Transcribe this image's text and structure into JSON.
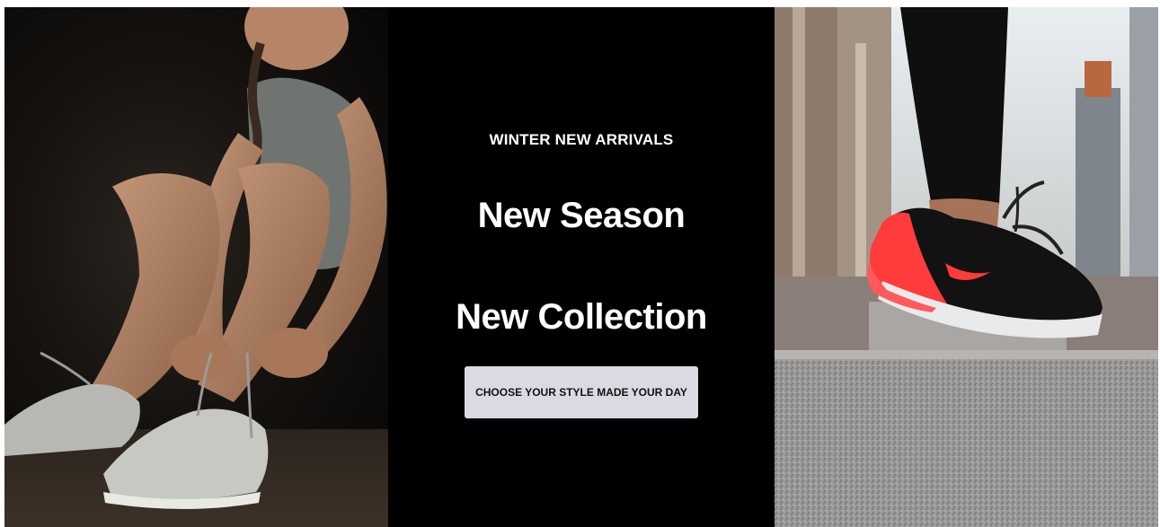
{
  "hero": {
    "eyebrow": "WINTER NEW ARRIVALS",
    "headline_1": "New Season",
    "headline_2": "New Collection",
    "cta_label": "CHOOSE YOUR STYLE MADE YOUR DAY"
  },
  "images": {
    "left": "photo-woman-tying-sneakers",
    "right": "photo-red-black-sneaker-jump"
  },
  "colors": {
    "center_bg": "#000000",
    "text": "#ffffff",
    "button_bg": "#dcd9e3",
    "button_text": "#111111",
    "shoe_accent": "#ff3b3b"
  }
}
